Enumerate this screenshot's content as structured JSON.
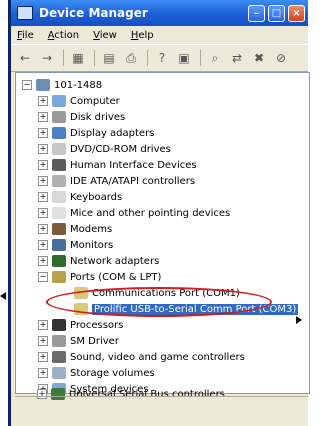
{
  "window": {
    "title": "Device Manager"
  },
  "menu": {
    "items": [
      "File",
      "Action",
      "View",
      "Help"
    ]
  },
  "toolbar": {
    "icons": [
      "back-icon",
      "forward-icon",
      "view-icon",
      "properties-icon",
      "print-icon",
      "help-icon",
      "refresh-icon",
      "scan-icon",
      "update-driver-icon",
      "uninstall-icon",
      "disable-icon"
    ]
  },
  "tree": {
    "root": "101-1488",
    "nodes": [
      "Computer",
      "Disk drives",
      "Display adapters",
      "DVD/CD-ROM drives",
      "Human Interface Devices",
      "IDE ATA/ATAPI controllers",
      "Keyboards",
      "Mice and other pointing devices",
      "Modems",
      "Monitors",
      "Network adapters",
      "Ports (COM & LPT)",
      "Processors",
      "SM Driver",
      "Sound, video and game controllers",
      "Storage volumes",
      "System devices",
      "Universal Serial Bus controllers"
    ],
    "ports_children": [
      "Communications Port (COM1)",
      "Prolific USB-to-Serial Comm Port (COM3)"
    ]
  }
}
